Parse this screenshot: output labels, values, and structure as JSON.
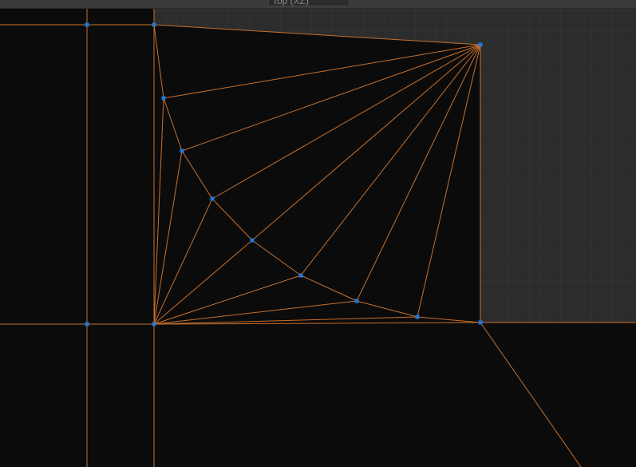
{
  "viewport": {
    "name": "Top (XZ)",
    "background_color": "#0b0b0c",
    "grid_background_color": "#2c2c2c",
    "grid_line_color": "#3a3a3a",
    "wire_color": "#c9702a",
    "vertex_color": "#1f78d9"
  }
}
